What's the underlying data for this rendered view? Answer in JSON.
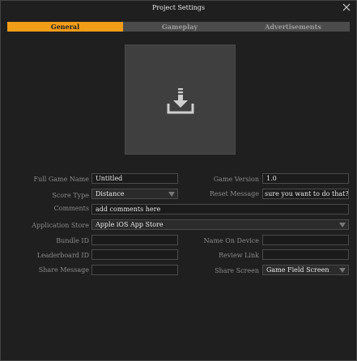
{
  "window": {
    "title": "Project Settings"
  },
  "tabs": [
    {
      "label": "General",
      "active": true
    },
    {
      "label": "Gameplay",
      "active": false
    },
    {
      "label": "Advertisements",
      "active": false
    }
  ],
  "icons": {
    "close": "close-icon",
    "upload": "download-tray-icon"
  },
  "colors": {
    "accent": "#f29d17",
    "background": "#1f1f1f",
    "field_bg": "#1b1b1b",
    "panel": "#3f3f3f"
  },
  "form": {
    "full_game_name": {
      "label": "Full Game Name",
      "value": "Untitled"
    },
    "game_version": {
      "label": "Game Version",
      "value": "1.0"
    },
    "score_type": {
      "label": "Score Type",
      "value": "Distance"
    },
    "reset_message": {
      "label": "Reset Message",
      "value": "sure you want to do that?"
    },
    "comments": {
      "label": "Comments",
      "value": "add comments here"
    },
    "application_store": {
      "label": "Application Store",
      "value": "Apple iOS App Store"
    },
    "bundle_id": {
      "label": "Bundle ID",
      "value": ""
    },
    "name_on_device": {
      "label": "Name On Device",
      "value": ""
    },
    "leaderboard_id": {
      "label": "Leaderboard ID",
      "value": ""
    },
    "review_link": {
      "label": "Review Link",
      "value": ""
    },
    "share_message": {
      "label": "Share Message",
      "value": ""
    },
    "share_screen": {
      "label": "Share Screen",
      "value": "Game Field Screen"
    }
  }
}
